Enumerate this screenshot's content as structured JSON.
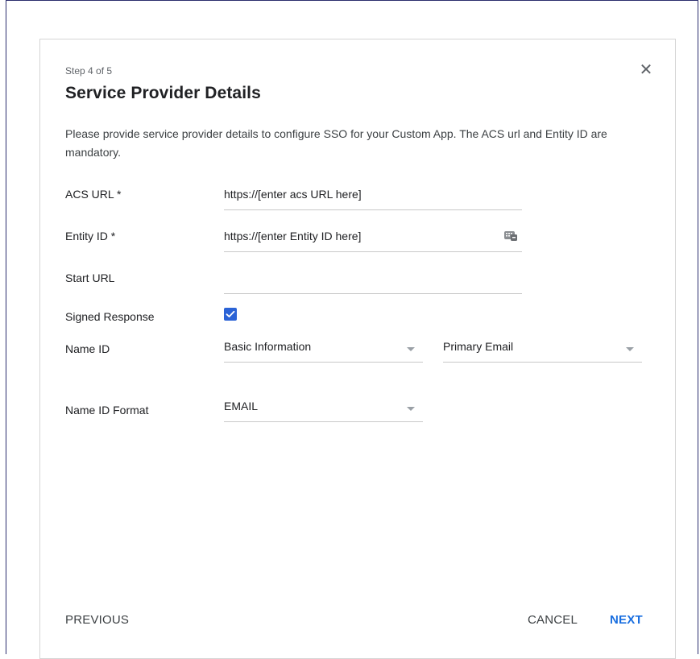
{
  "dialog": {
    "step": "Step 4 of 5",
    "title": "Service Provider Details",
    "description": "Please provide service provider details to configure SSO for your Custom App. The ACS url and Entity ID are mandatory.",
    "close_icon": "close-icon"
  },
  "form": {
    "acs_url": {
      "label": "ACS URL *",
      "value": "https://[enter acs URL here]"
    },
    "entity_id": {
      "label": "Entity ID *",
      "value": "https://[enter Entity ID here]",
      "icon": "keyboard-icon"
    },
    "start_url": {
      "label": "Start URL",
      "value": ""
    },
    "signed_response": {
      "label": "Signed Response",
      "checked": true
    },
    "name_id": {
      "label": "Name ID",
      "category": "Basic Information",
      "attribute": "Primary Email"
    },
    "name_id_format": {
      "label": "Name ID Format",
      "value": "EMAIL"
    }
  },
  "footer": {
    "previous": "PREVIOUS",
    "cancel": "CANCEL",
    "next": "NEXT"
  },
  "colors": {
    "accent": "#1a6fe0",
    "checkbox": "#2b63d6"
  }
}
